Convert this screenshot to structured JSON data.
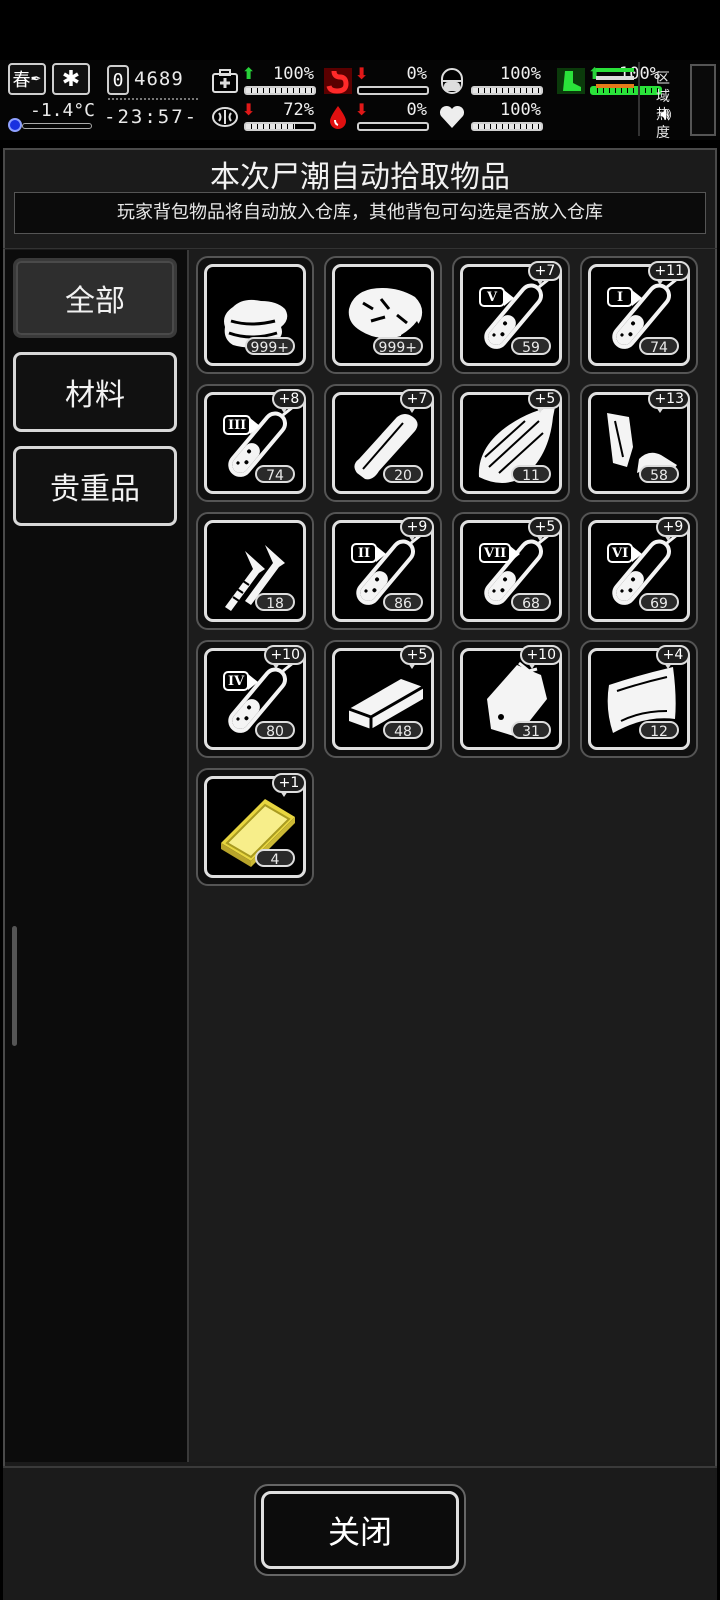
{
  "hud": {
    "season": "春",
    "temperature": "-1.4°C",
    "day_counter": "0",
    "money": "4689",
    "clock": "-23:57-",
    "stats": [
      {
        "icon": "medkit-icon",
        "trend": "up",
        "value": "100%",
        "fill": 1.0
      },
      {
        "icon": "brain-icon",
        "trend": "down",
        "value": "72%",
        "fill": 0.72
      },
      {
        "icon": "stomach-icon",
        "trend": "down",
        "value": "0%",
        "fill": 0.0
      },
      {
        "icon": "blood-drop-icon",
        "trend": "down",
        "value": "0%",
        "fill": 0.0
      },
      {
        "icon": "pill-icon",
        "trend": "none",
        "value": "100%",
        "fill": 1.0
      },
      {
        "icon": "heart-icon",
        "trend": "none",
        "value": "100%",
        "fill": 1.0
      },
      {
        "icon": "boot-icon",
        "trend": "up",
        "value": "100%",
        "fill": 1.0
      }
    ],
    "zone_heat_label": "区域热度"
  },
  "dialog": {
    "title": "本次尸潮自动拾取物品",
    "subtitle": "玩家背包物品将自动放入仓库，其他背包可勾选是否放入仓库",
    "tabs": [
      "全部",
      "材料",
      "贵重品"
    ],
    "active_tab": "全部",
    "close_label": "关闭"
  },
  "items": [
    {
      "name": "cloth",
      "icon": "cloth-icon",
      "count": "999+",
      "badge": ""
    },
    {
      "name": "meat",
      "icon": "meat-icon",
      "count": "999+",
      "badge": ""
    },
    {
      "name": "reagent-v",
      "icon": "test-tube-icon",
      "roman": "V",
      "count": "59",
      "badge": "+7"
    },
    {
      "name": "reagent-i",
      "icon": "test-tube-icon",
      "roman": "I",
      "count": "74",
      "badge": "+11"
    },
    {
      "name": "reagent-iii",
      "icon": "test-tube-icon",
      "roman": "III",
      "count": "74",
      "badge": "+8"
    },
    {
      "name": "bone",
      "icon": "bone-icon",
      "count": "20",
      "badge": "+7"
    },
    {
      "name": "wood-plank",
      "icon": "wood-plank-icon",
      "count": "11",
      "badge": "+5"
    },
    {
      "name": "scrap-metal",
      "icon": "scrap-metal-icon",
      "count": "58",
      "badge": "+13"
    },
    {
      "name": "nails",
      "icon": "nails-icon",
      "count": "18",
      "badge": ""
    },
    {
      "name": "reagent-ii",
      "icon": "test-tube-icon",
      "roman": "II",
      "count": "86",
      "badge": "+9"
    },
    {
      "name": "reagent-vii",
      "icon": "test-tube-icon",
      "roman": "VII",
      "count": "68",
      "badge": "+5"
    },
    {
      "name": "reagent-vi",
      "icon": "test-tube-icon",
      "roman": "VI",
      "count": "69",
      "badge": "+9"
    },
    {
      "name": "reagent-iv",
      "icon": "test-tube-icon",
      "roman": "IV",
      "count": "80",
      "badge": "+10"
    },
    {
      "name": "brick",
      "icon": "brick-icon",
      "count": "48",
      "badge": "+5"
    },
    {
      "name": "metal-sheet",
      "icon": "metal-sheet-icon",
      "count": "31",
      "badge": "+10"
    },
    {
      "name": "leather",
      "icon": "leather-icon",
      "count": "12",
      "badge": "+4"
    },
    {
      "name": "gold-plate",
      "icon": "gold-plate-icon",
      "count": "4",
      "badge": "+1"
    }
  ]
}
